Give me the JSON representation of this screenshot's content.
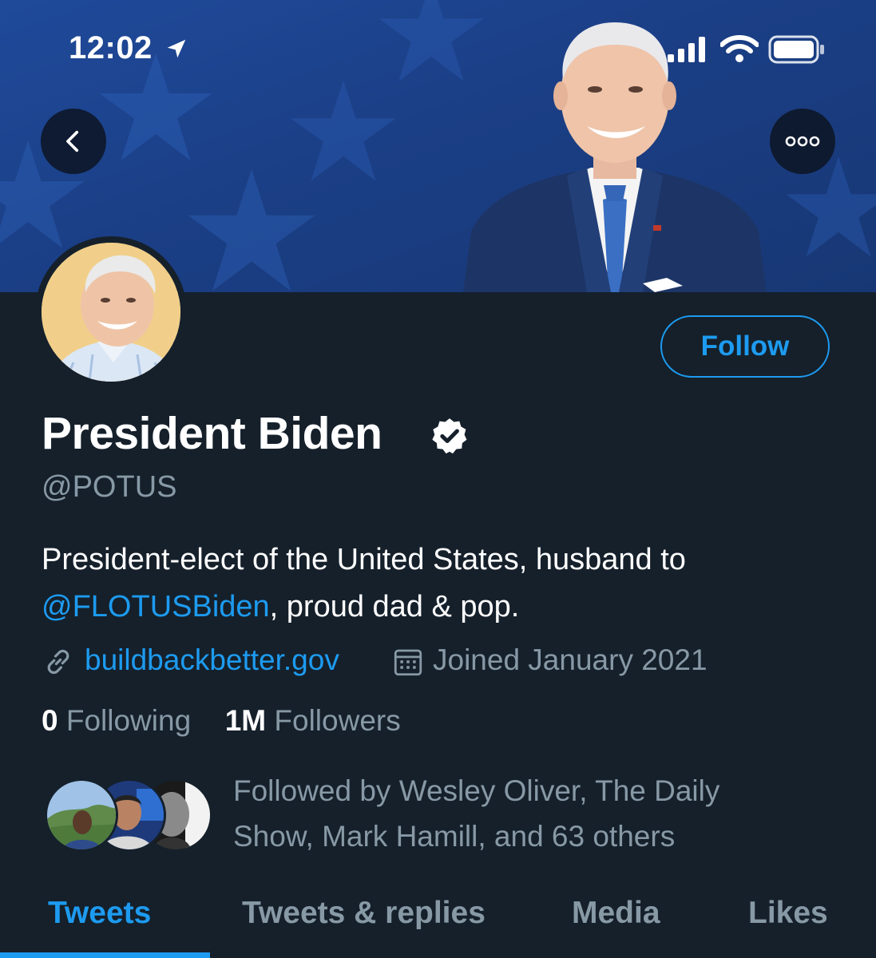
{
  "status_bar": {
    "time": "12:02",
    "icons": [
      "location-arrow-icon",
      "cellular-signal-icon",
      "wifi-icon",
      "battery-icon"
    ]
  },
  "header": {
    "back_icon": "chevron-left-icon",
    "more_icon": "more-horizontal-icon"
  },
  "profile": {
    "follow_label": "Follow",
    "name": "President Biden",
    "verified_icon": "verified-badge-icon",
    "handle": "@POTUS",
    "bio_text_1": "President-elect of the United States, husband to ",
    "bio_mention": "@FLOTUSBiden",
    "bio_text_2": ", proud dad & pop.",
    "website": "buildbackbetter.gov",
    "joined": "Joined January 2021",
    "following_count": "0",
    "following_label": "Following",
    "followers_count": "1M",
    "followers_label": "Followers",
    "followed_by": "Followed by Wesley Oliver, The Daily Show, Mark Hamill, and 63 others"
  },
  "tabs": [
    {
      "label": "Tweets",
      "active": true
    },
    {
      "label": "Tweets & replies",
      "active": false
    },
    {
      "label": "Media",
      "active": false
    },
    {
      "label": "Likes",
      "active": false
    }
  ],
  "colors": {
    "background": "#15202b",
    "accent": "#1d9bf0",
    "secondary_text": "#8899a6",
    "banner": "#1f4a9a"
  }
}
